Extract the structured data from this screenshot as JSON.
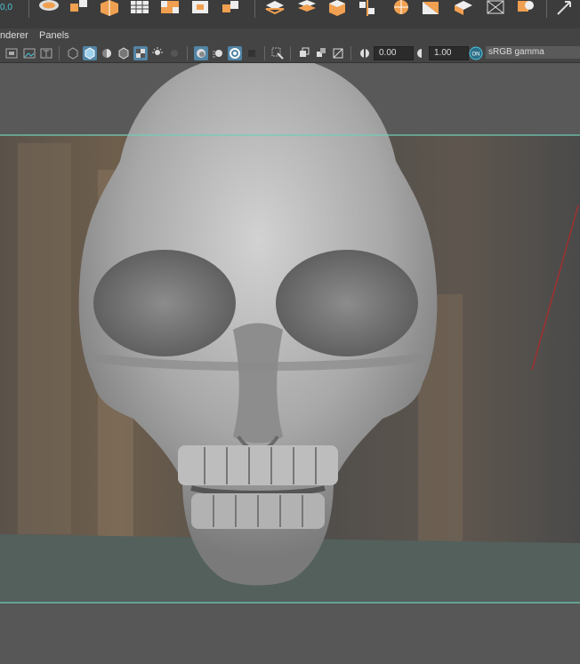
{
  "shelf": {
    "readout": "0,0",
    "icons": [
      "bowl-icon",
      "polygon-cube-icon",
      "extrude-icon",
      "grid-cube-icon",
      "checker-grid-icon",
      "fill-hole-icon",
      "move-cube-icon",
      "layers-icon",
      "polygon-cube-icon",
      "mirror-icon",
      "sphere-icon",
      "bevel-icon",
      "crease-icon",
      "wireframe-cube-icon",
      "display-icon",
      "arrow-icon"
    ]
  },
  "menu": {
    "items": [
      "nderer",
      "Panels"
    ]
  },
  "toolbar": {
    "exposure_value": "0.00",
    "gamma_value": "1.00",
    "cm_badge": "ON",
    "color_space": "sRGB gamma"
  },
  "colors": {
    "accent": "#5285a6",
    "gate_line": "#6fd0b8",
    "readout": "#4ec3d8",
    "icon_orange": "#f0a050"
  }
}
